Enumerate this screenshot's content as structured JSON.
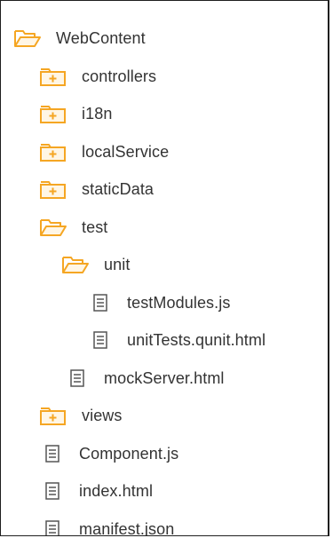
{
  "tree": [
    {
      "label": "WebContent",
      "type": "folder-open",
      "depth": 0
    },
    {
      "label": "controllers",
      "type": "folder-closed",
      "depth": 1
    },
    {
      "label": "i18n",
      "type": "folder-closed",
      "depth": 1
    },
    {
      "label": "localService",
      "type": "folder-closed",
      "depth": 1
    },
    {
      "label": "staticData",
      "type": "folder-closed",
      "depth": 1
    },
    {
      "label": "test",
      "type": "folder-open",
      "depth": 1
    },
    {
      "label": "unit",
      "type": "folder-open",
      "depth": 2
    },
    {
      "label": "testModules.js",
      "type": "file",
      "depth": 3
    },
    {
      "label": "unitTests.qunit.html",
      "type": "file",
      "depth": 3
    },
    {
      "label": "mockServer.html",
      "type": "file",
      "depth": 2
    },
    {
      "label": "views",
      "type": "folder-closed",
      "depth": 1
    },
    {
      "label": "Component.js",
      "type": "file",
      "depth": 1
    },
    {
      "label": "index.html",
      "type": "file",
      "depth": 1
    },
    {
      "label": "manifest.json",
      "type": "file",
      "depth": 1
    }
  ],
  "colors": {
    "folder": "#F5A623",
    "file": "#555555",
    "text": "#333333",
    "border": "#1F1F1F"
  }
}
